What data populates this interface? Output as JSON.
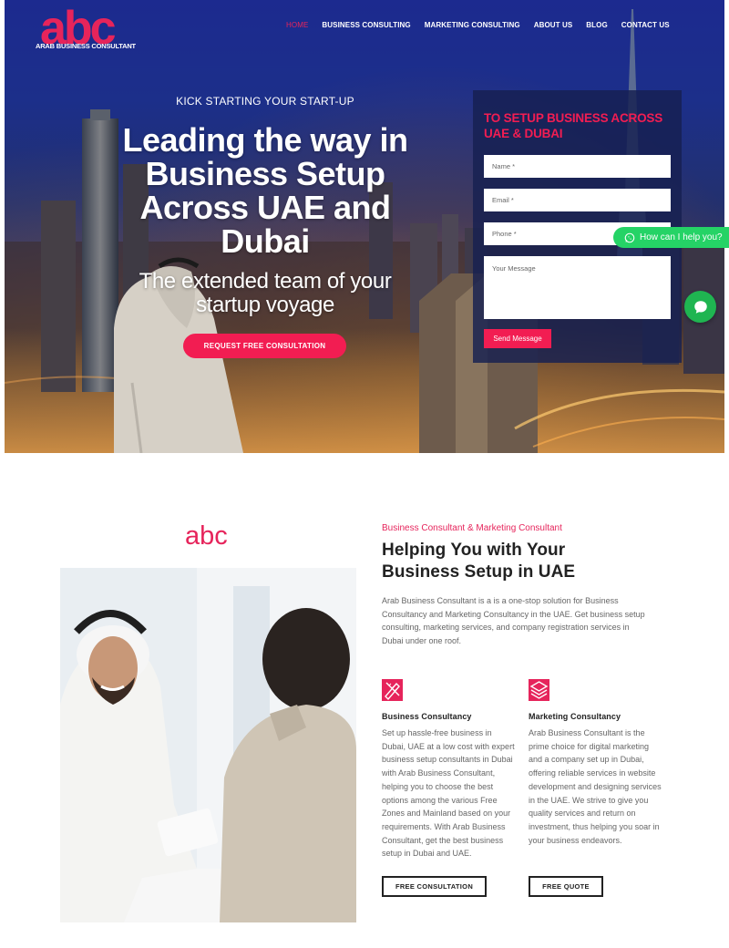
{
  "brand": {
    "logo_text": "abc",
    "logo_caption": "ARAB BUSINESS CONSULTANT",
    "accent_color": "#e6245b"
  },
  "nav": {
    "items": [
      {
        "label": "HOME",
        "active": true
      },
      {
        "label": "BUSINESS CONSULTING",
        "active": false
      },
      {
        "label": "MARKETING CONSULTING",
        "active": false
      },
      {
        "label": "ABOUT US",
        "active": false
      },
      {
        "label": "BLOG",
        "active": false
      },
      {
        "label": "CONTACT US",
        "active": false
      }
    ]
  },
  "hero": {
    "kicker": "KICK STARTING YOUR START-UP",
    "headline": "Leading the way in Business Setup Across UAE and Dubai",
    "subheadline": "The extended team of your startup voyage",
    "cta_label": "REQUEST FREE CONSULTATION"
  },
  "form": {
    "title": "TO SETUP BUSINESS ACROSS UAE & DUBAI",
    "name_placeholder": "Name *",
    "email_placeholder": "Email *",
    "phone_placeholder": "Phone *",
    "message_placeholder": "Your Message",
    "submit_label": "Send Message"
  },
  "whatsapp": {
    "label": "How can I help you?",
    "icon": "whatsapp-icon",
    "color": "#25d366"
  },
  "about": {
    "brand_mark": "abc",
    "eyebrow": "Business Consultant & Marketing Consultant",
    "title": "Helping You with Your Business Setup in UAE",
    "intro": "Arab Business Consultant is a is a one-stop solution for Business Consultancy and Marketing Consultancy in the UAE. Get business setup consulting, marketing services, and company registration services in Dubai under one roof.",
    "services": [
      {
        "icon": "pen-ruler-icon",
        "title": "Business Consultancy",
        "body": "Set up hassle-free business in Dubai, UAE at a low cost with expert business setup consultants in Dubai with Arab Business Consultant, helping you to choose the best options among the various Free Zones and Mainland based on your requirements. With Arab Business Consultant, get the best business setup in Dubai and UAE.",
        "button": "FREE CONSULTATION"
      },
      {
        "icon": "layers-icon",
        "title": "Marketing Consultancy",
        "body": "Arab Business Consultant is the prime choice for digital marketing and a company set up in Dubai, offering reliable services in website development and designing services in the UAE. We strive to give you quality services and return on investment, thus helping you soar in your business endeavors.",
        "button": "FREE QUOTE"
      }
    ]
  }
}
